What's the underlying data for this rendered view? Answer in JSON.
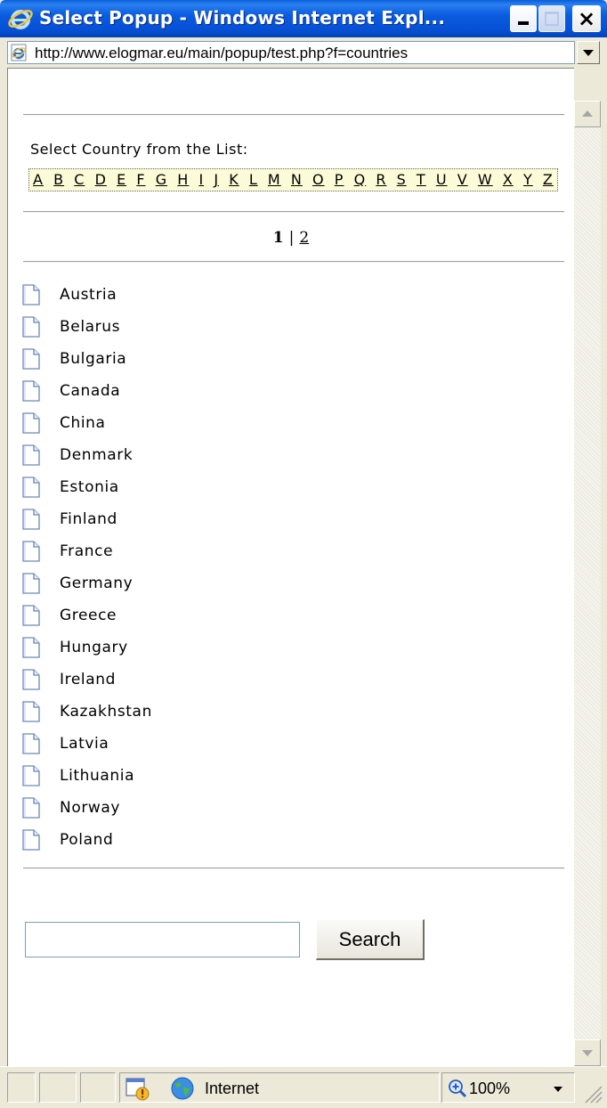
{
  "window": {
    "title": "Select Popup - Windows Internet Expl...",
    "address": "http://www.elogmar.eu/main/popup/test.php?f=countries"
  },
  "page": {
    "select_label": "Select Country from the List:",
    "letters": [
      "A",
      "B",
      "C",
      "D",
      "E",
      "F",
      "G",
      "H",
      "I",
      "J",
      "K",
      "L",
      "M",
      "N",
      "O",
      "P",
      "Q",
      "R",
      "S",
      "T",
      "U",
      "V",
      "W",
      "X",
      "Y",
      "Z"
    ],
    "pagination": {
      "current": "1",
      "separator": "|",
      "next": "2"
    },
    "countries": [
      "Austria",
      "Belarus",
      "Bulgaria",
      "Canada",
      "China",
      "Denmark",
      "Estonia",
      "Finland",
      "France",
      "Germany",
      "Greece",
      "Hungary",
      "Ireland",
      "Kazakhstan",
      "Latvia",
      "Lithuania",
      "Norway",
      "Poland"
    ],
    "search": {
      "value": "",
      "button_label": "Search"
    }
  },
  "status": {
    "zone": "Internet",
    "zoom": "100%"
  }
}
